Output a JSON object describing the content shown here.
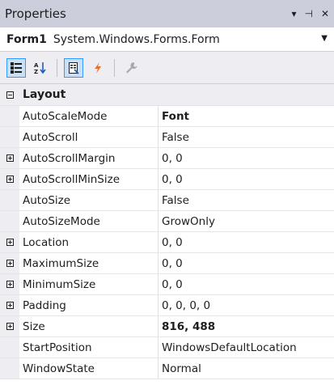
{
  "window": {
    "title": "Properties",
    "controls": [
      "▾",
      "⊣",
      "✕"
    ]
  },
  "object_selector": {
    "name": "Form1",
    "type": "System.Windows.Forms.Form"
  },
  "toolbar": {
    "buttons": [
      "categorized-icon",
      "alphabetical-icon",
      "properties-icon",
      "events-icon",
      "property-pages-icon"
    ],
    "active": [
      "categorized-icon",
      "properties-icon"
    ]
  },
  "grid": {
    "category": "Layout",
    "rows": [
      {
        "name": "AutoScaleMode",
        "value": "Font",
        "expandable": false,
        "bold": true
      },
      {
        "name": "AutoScroll",
        "value": "False",
        "expandable": false,
        "bold": false
      },
      {
        "name": "AutoScrollMargin",
        "value": "0, 0",
        "expandable": true,
        "bold": false
      },
      {
        "name": "AutoScrollMinSize",
        "value": "0, 0",
        "expandable": true,
        "bold": false
      },
      {
        "name": "AutoSize",
        "value": "False",
        "expandable": false,
        "bold": false
      },
      {
        "name": "AutoSizeMode",
        "value": "GrowOnly",
        "expandable": false,
        "bold": false
      },
      {
        "name": "Location",
        "value": "0, 0",
        "expandable": true,
        "bold": false
      },
      {
        "name": "MaximumSize",
        "value": "0, 0",
        "expandable": true,
        "bold": false
      },
      {
        "name": "MinimumSize",
        "value": "0, 0",
        "expandable": true,
        "bold": false
      },
      {
        "name": "Padding",
        "value": "0, 0, 0, 0",
        "expandable": true,
        "bold": false
      },
      {
        "name": "Size",
        "value": "816, 488",
        "expandable": true,
        "bold": true
      },
      {
        "name": "StartPosition",
        "value": "WindowsDefaultLocation",
        "expandable": false,
        "bold": false
      },
      {
        "name": "WindowState",
        "value": "Normal",
        "expandable": false,
        "bold": false
      }
    ]
  }
}
